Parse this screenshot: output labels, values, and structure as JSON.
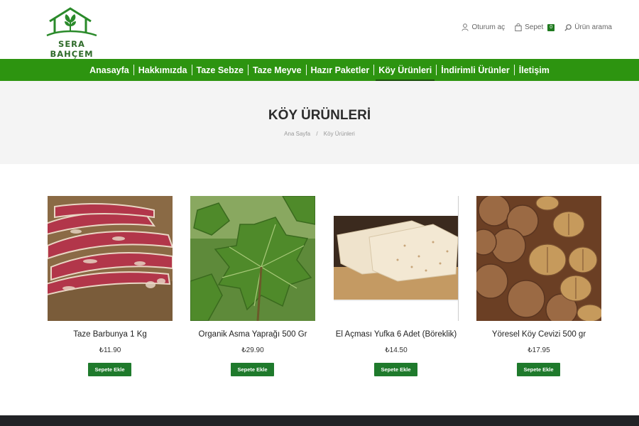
{
  "header": {
    "logo_text": "SERA BAHÇEM",
    "links": {
      "login": "Oturum aç",
      "cart": "Sepet",
      "cart_count": "0",
      "search": "Ürün arama"
    }
  },
  "nav": {
    "items": [
      {
        "label": "Anasayfa"
      },
      {
        "label": "Hakkımızda"
      },
      {
        "label": "Taze Sebze"
      },
      {
        "label": "Taze Meyve"
      },
      {
        "label": "Hazır Paketler"
      },
      {
        "label": "Köy Ürünleri",
        "active": true
      },
      {
        "label": "İndirimli Ürünler"
      },
      {
        "label": "İletişim"
      }
    ],
    "color": "#2d9410"
  },
  "page": {
    "title": "KÖY ÜRÜNLERİ",
    "breadcrumb": {
      "home": "Ana Sayfa",
      "separator": "/",
      "current": "Köy Ürünleri"
    }
  },
  "products": [
    {
      "name": "Taze Barbunya 1 Kg",
      "price": "₺11.90",
      "button": "Sepete Ekle"
    },
    {
      "name": "Organik Asma Yaprağı 500 Gr",
      "price": "₺29.90",
      "button": "Sepete Ekle"
    },
    {
      "name": "El Açması Yufka 6 Adet (Böreklik)",
      "price": "₺14.50",
      "button": "Sepete Ekle"
    },
    {
      "name": "Yöresel Köy Cevizi 500 gr",
      "price": "₺17.95",
      "button": "Sepete Ekle"
    }
  ],
  "colors": {
    "brand_green": "#2d9410",
    "button_green": "#1f7a2c",
    "footer": "#222326"
  }
}
